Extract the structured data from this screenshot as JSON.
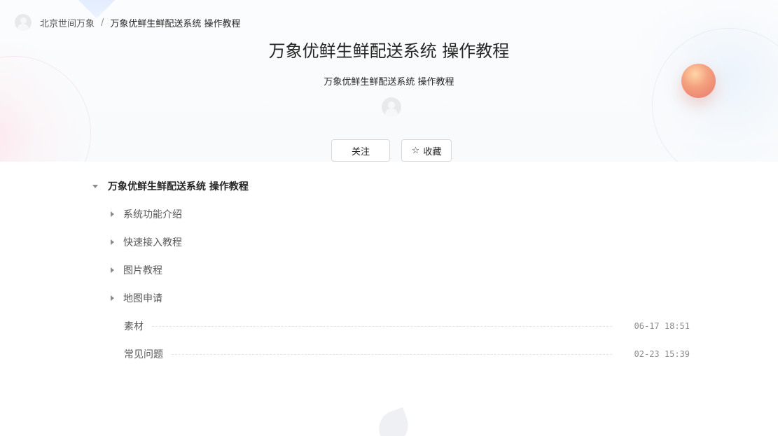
{
  "breadcrumb": {
    "group": "北京世间万象",
    "separator": "/",
    "current": "万象优鲜生鲜配送系统 操作教程"
  },
  "book": {
    "title": "万象优鲜生鲜配送系统 操作教程",
    "description": "万象优鲜生鲜配送系统 操作教程"
  },
  "actions": {
    "follow_label": "关注",
    "star_icon": "☆",
    "star_label": "收藏"
  },
  "catalog": {
    "root": "万象优鲜生鲜配送系统 操作教程",
    "groups": [
      "系统功能介绍",
      "快速接入教程",
      "图片教程",
      "地图申请"
    ],
    "docs": [
      {
        "title": "素材",
        "time": "06-17 18:51"
      },
      {
        "title": "常见问题",
        "time": "02-23 15:39"
      }
    ]
  },
  "colors": {
    "accent_orb": "#e8766a",
    "text": "#262626",
    "muted": "#8c8c8c"
  }
}
